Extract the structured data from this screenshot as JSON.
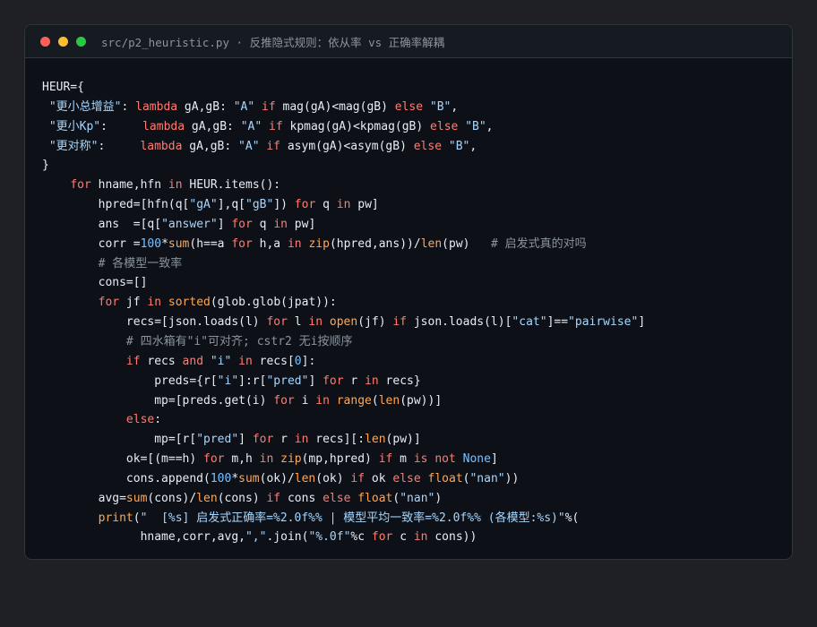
{
  "window": {
    "title": "src/p2_heuristic.py · 反推隐式规则：依从率 vs 正确率解耦",
    "traffic_lights": [
      {
        "name": "close",
        "color": "#ff5f57"
      },
      {
        "name": "minimize",
        "color": "#febc2e"
      },
      {
        "name": "zoom",
        "color": "#28c840"
      }
    ]
  },
  "colors": {
    "keyword": "#ff7b72",
    "string": "#a5d6ff",
    "number": "#79c0ff",
    "builtin": "#ffa657",
    "comment": "#8b949e",
    "text": "#e6edf3",
    "background": "#0d1117"
  },
  "code_lines": [
    [
      [
        "pl",
        "HEUR={"
      ]
    ],
    [
      [
        "pl",
        " "
      ],
      [
        "str",
        "\"更小总增益\""
      ],
      [
        "pl",
        ": "
      ],
      [
        "kw",
        "lambda"
      ],
      [
        "pl",
        " gA,gB: "
      ],
      [
        "str",
        "\"A\""
      ],
      [
        "pl",
        " "
      ],
      [
        "kw",
        "if"
      ],
      [
        "pl",
        " mag(gA)<mag(gB) "
      ],
      [
        "kw",
        "else"
      ],
      [
        "pl",
        " "
      ],
      [
        "str",
        "\"B\""
      ],
      [
        "pl",
        ","
      ]
    ],
    [
      [
        "pl",
        " "
      ],
      [
        "str",
        "\"更小Kp\""
      ],
      [
        "pl",
        ":     "
      ],
      [
        "kw",
        "lambda"
      ],
      [
        "pl",
        " gA,gB: "
      ],
      [
        "str",
        "\"A\""
      ],
      [
        "pl",
        " "
      ],
      [
        "kw",
        "if"
      ],
      [
        "pl",
        " kpmag(gA)<kpmag(gB) "
      ],
      [
        "kw",
        "else"
      ],
      [
        "pl",
        " "
      ],
      [
        "str",
        "\"B\""
      ],
      [
        "pl",
        ","
      ]
    ],
    [
      [
        "pl",
        " "
      ],
      [
        "str",
        "\"更对称\""
      ],
      [
        "pl",
        ":     "
      ],
      [
        "kw",
        "lambda"
      ],
      [
        "pl",
        " gA,gB: "
      ],
      [
        "str",
        "\"A\""
      ],
      [
        "pl",
        " "
      ],
      [
        "kw",
        "if"
      ],
      [
        "pl",
        " asym(gA)<asym(gB) "
      ],
      [
        "kw",
        "else"
      ],
      [
        "pl",
        " "
      ],
      [
        "str",
        "\"B\""
      ],
      [
        "pl",
        ","
      ]
    ],
    [
      [
        "pl",
        "}"
      ]
    ],
    [
      [
        "pl",
        "    "
      ],
      [
        "kw",
        "for"
      ],
      [
        "pl",
        " hname,hfn "
      ],
      [
        "kw",
        "in"
      ],
      [
        "pl",
        " HEUR.items():"
      ]
    ],
    [
      [
        "pl",
        "        hpred=[hfn(q["
      ],
      [
        "str",
        "\"gA\""
      ],
      [
        "pl",
        "],q["
      ],
      [
        "str",
        "\"gB\""
      ],
      [
        "pl",
        "]) "
      ],
      [
        "kw",
        "for"
      ],
      [
        "pl",
        " q "
      ],
      [
        "kw",
        "in"
      ],
      [
        "pl",
        " pw]"
      ]
    ],
    [
      [
        "pl",
        "        ans  =[q["
      ],
      [
        "str",
        "\"answer\""
      ],
      [
        "pl",
        "] "
      ],
      [
        "kw",
        "for"
      ],
      [
        "pl",
        " q "
      ],
      [
        "kw",
        "in"
      ],
      [
        "pl",
        " pw]"
      ]
    ],
    [
      [
        "pl",
        "        corr ="
      ],
      [
        "num",
        "100"
      ],
      [
        "pl",
        "*"
      ],
      [
        "bi",
        "sum"
      ],
      [
        "pl",
        "(h==a "
      ],
      [
        "kw",
        "for"
      ],
      [
        "pl",
        " h,a "
      ],
      [
        "kw",
        "in"
      ],
      [
        "pl",
        " "
      ],
      [
        "bi",
        "zip"
      ],
      [
        "pl",
        "(hpred,ans))/"
      ],
      [
        "bi",
        "len"
      ],
      [
        "pl",
        "(pw)   "
      ],
      [
        "cm",
        "# 启发式真的对吗"
      ]
    ],
    [
      [
        "pl",
        "        "
      ],
      [
        "cm",
        "# 各模型一致率"
      ]
    ],
    [
      [
        "pl",
        "        cons=[]"
      ]
    ],
    [
      [
        "pl",
        "        "
      ],
      [
        "kw",
        "for"
      ],
      [
        "pl",
        " jf "
      ],
      [
        "kw",
        "in"
      ],
      [
        "pl",
        " "
      ],
      [
        "bi",
        "sorted"
      ],
      [
        "pl",
        "(glob.glob(jpat)):"
      ]
    ],
    [
      [
        "pl",
        "            recs=[json.loads(l) "
      ],
      [
        "kw",
        "for"
      ],
      [
        "pl",
        " l "
      ],
      [
        "kw",
        "in"
      ],
      [
        "pl",
        " "
      ],
      [
        "bi",
        "open"
      ],
      [
        "pl",
        "(jf) "
      ],
      [
        "kw",
        "if"
      ],
      [
        "pl",
        " json.loads(l)["
      ],
      [
        "str",
        "\"cat\""
      ],
      [
        "pl",
        "]=="
      ],
      [
        "str",
        "\"pairwise\""
      ],
      [
        "pl",
        "]"
      ]
    ],
    [
      [
        "pl",
        "            "
      ],
      [
        "cm",
        "# 四水箱有\"i\"可对齐; cstr2 无i按顺序"
      ]
    ],
    [
      [
        "pl",
        "            "
      ],
      [
        "kw",
        "if"
      ],
      [
        "pl",
        " recs "
      ],
      [
        "kw",
        "and"
      ],
      [
        "pl",
        " "
      ],
      [
        "str",
        "\"i\""
      ],
      [
        "pl",
        " "
      ],
      [
        "kw",
        "in"
      ],
      [
        "pl",
        " recs["
      ],
      [
        "num",
        "0"
      ],
      [
        "pl",
        "]:"
      ]
    ],
    [
      [
        "pl",
        "                preds={r["
      ],
      [
        "str",
        "\"i\""
      ],
      [
        "pl",
        "]:r["
      ],
      [
        "str",
        "\"pred\""
      ],
      [
        "pl",
        "] "
      ],
      [
        "kw",
        "for"
      ],
      [
        "pl",
        " r "
      ],
      [
        "kw",
        "in"
      ],
      [
        "pl",
        " recs}"
      ]
    ],
    [
      [
        "pl",
        "                mp=[preds.get(i) "
      ],
      [
        "kw",
        "for"
      ],
      [
        "pl",
        " i "
      ],
      [
        "kw",
        "in"
      ],
      [
        "pl",
        " "
      ],
      [
        "bi",
        "range"
      ],
      [
        "pl",
        "("
      ],
      [
        "bi",
        "len"
      ],
      [
        "pl",
        "(pw))]"
      ]
    ],
    [
      [
        "pl",
        "            "
      ],
      [
        "kw",
        "else"
      ],
      [
        "pl",
        ":"
      ]
    ],
    [
      [
        "pl",
        "                mp=[r["
      ],
      [
        "str",
        "\"pred\""
      ],
      [
        "pl",
        "] "
      ],
      [
        "kw",
        "for"
      ],
      [
        "pl",
        " r "
      ],
      [
        "kw",
        "in"
      ],
      [
        "pl",
        " recs][:"
      ],
      [
        "bi",
        "len"
      ],
      [
        "pl",
        "(pw)]"
      ]
    ],
    [
      [
        "pl",
        "            ok=[(m==h) "
      ],
      [
        "kw",
        "for"
      ],
      [
        "pl",
        " m,h "
      ],
      [
        "kw",
        "in"
      ],
      [
        "pl",
        " "
      ],
      [
        "bi",
        "zip"
      ],
      [
        "pl",
        "(mp,hpred) "
      ],
      [
        "kw",
        "if"
      ],
      [
        "pl",
        " m "
      ],
      [
        "kw",
        "is not"
      ],
      [
        "pl",
        " "
      ],
      [
        "num",
        "None"
      ],
      [
        "pl",
        "]"
      ]
    ],
    [
      [
        "pl",
        "            cons.append("
      ],
      [
        "num",
        "100"
      ],
      [
        "pl",
        "*"
      ],
      [
        "bi",
        "sum"
      ],
      [
        "pl",
        "(ok)/"
      ],
      [
        "bi",
        "len"
      ],
      [
        "pl",
        "(ok) "
      ],
      [
        "kw",
        "if"
      ],
      [
        "pl",
        " ok "
      ],
      [
        "kw",
        "else"
      ],
      [
        "pl",
        " "
      ],
      [
        "bi",
        "float"
      ],
      [
        "pl",
        "("
      ],
      [
        "str",
        "\"nan\""
      ],
      [
        "pl",
        "))"
      ]
    ],
    [
      [
        "pl",
        "        avg="
      ],
      [
        "bi",
        "sum"
      ],
      [
        "pl",
        "(cons)/"
      ],
      [
        "bi",
        "len"
      ],
      [
        "pl",
        "(cons) "
      ],
      [
        "kw",
        "if"
      ],
      [
        "pl",
        " cons "
      ],
      [
        "kw",
        "else"
      ],
      [
        "pl",
        " "
      ],
      [
        "bi",
        "float"
      ],
      [
        "pl",
        "("
      ],
      [
        "str",
        "\"nan\""
      ],
      [
        "pl",
        ")"
      ]
    ],
    [
      [
        "pl",
        "        "
      ],
      [
        "bi",
        "print"
      ],
      [
        "pl",
        "("
      ],
      [
        "str",
        "\"  [%s] 启发式正确率=%2.0f%% | 模型平均一致率=%2.0f%% (各模型:%s)\""
      ],
      [
        "pl",
        "%("
      ]
    ],
    [
      [
        "pl",
        "              hname,corr,avg,"
      ],
      [
        "str",
        "\",\""
      ],
      [
        "pl",
        ".join("
      ],
      [
        "str",
        "\"%.0f\""
      ],
      [
        "pl",
        "%c "
      ],
      [
        "kw",
        "for"
      ],
      [
        "pl",
        " c "
      ],
      [
        "kw",
        "in"
      ],
      [
        "pl",
        " cons))"
      ]
    ]
  ]
}
